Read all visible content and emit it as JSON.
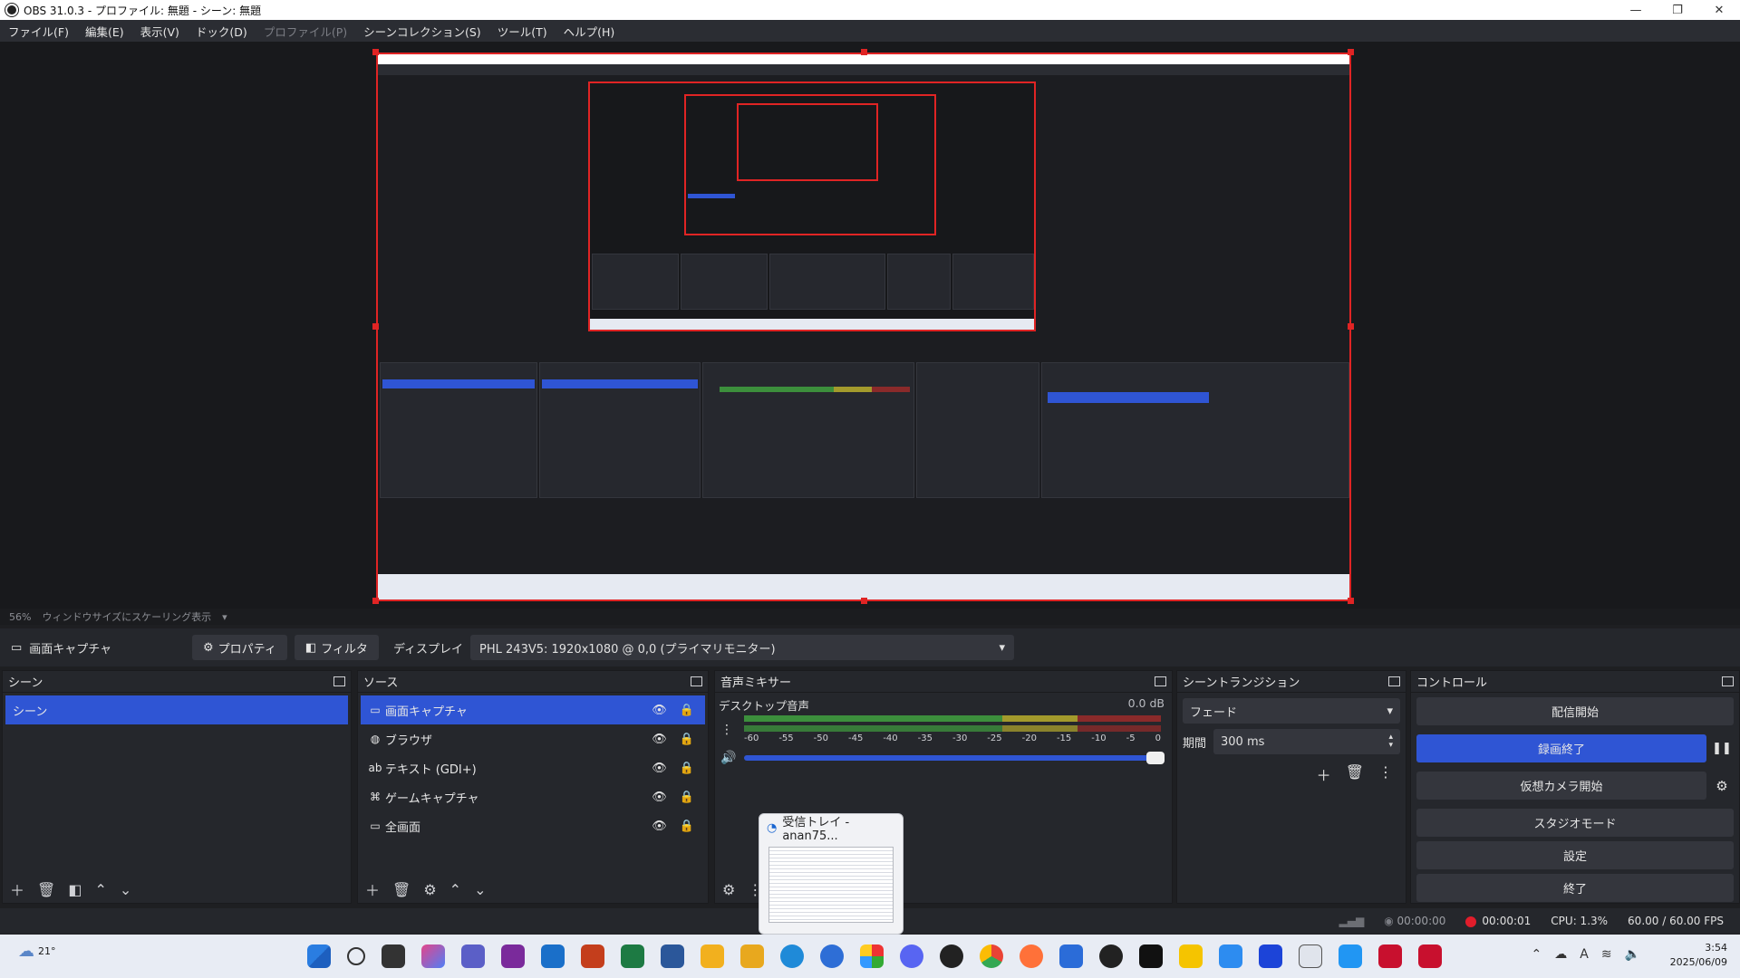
{
  "window": {
    "title": "OBS 31.0.3 - プロファイル: 無題 - シーン: 無題"
  },
  "menu": [
    "ファイル(F)",
    "編集(E)",
    "表示(V)",
    "ドック(D)",
    "プロファイル(P)",
    "シーンコレクション(S)",
    "ツール(T)",
    "ヘルプ(H)"
  ],
  "scale": {
    "zoom": "56%",
    "label": "ウィンドウサイズにスケーリング表示"
  },
  "toolbar": {
    "source_name": "画面キャプチャ",
    "properties": "プロパティ",
    "filters": "フィルタ",
    "display_label": "ディスプレイ",
    "display_value": "PHL 243V5: 1920x1080 @ 0,0 (プライマリモニター)"
  },
  "scenes": {
    "title": "シーン",
    "items": [
      "シーン"
    ]
  },
  "sources": {
    "title": "ソース",
    "items": [
      {
        "icon": "monitor-icon",
        "label": "画面キャプチャ"
      },
      {
        "icon": "globe-icon",
        "label": "ブラウザ"
      },
      {
        "icon": "text-icon",
        "label": "テキスト (GDI+)"
      },
      {
        "icon": "gamepad-icon",
        "label": "ゲームキャプチャ"
      },
      {
        "icon": "monitor-icon",
        "label": "全画面"
      }
    ]
  },
  "mixer": {
    "title": "音声ミキサー",
    "channel": "デスクトップ音声",
    "db": "0.0 dB",
    "ticks": [
      "-60",
      "-55",
      "-50",
      "-45",
      "-40",
      "-35",
      "-30",
      "-25",
      "-20",
      "-15",
      "-10",
      "-5",
      "0"
    ],
    "volume": 1.0
  },
  "transitions": {
    "title": "シーントランジション",
    "type": "フェード",
    "duration_label": "期間",
    "duration": "300 ms"
  },
  "controls": {
    "title": "コントロール",
    "start_stream": "配信開始",
    "stop_record": "録画終了",
    "virtual_cam": "仮想カメラ開始",
    "studio_mode": "スタジオモード",
    "settings": "設定",
    "exit": "終了"
  },
  "status": {
    "stream_time": "00:00:00",
    "rec_time": "00:00:01",
    "cpu": "CPU: 1.3%",
    "fps": "60.00 / 60.00 FPS"
  },
  "popup": {
    "title": "受信トレイ - anan75..."
  },
  "taskbar": {
    "weather": "21°",
    "time": "3:54",
    "date": "2025/06/09"
  },
  "colors": {
    "accent": "#2f55d4",
    "record": "#e11d2b",
    "outline": "#e02424"
  }
}
